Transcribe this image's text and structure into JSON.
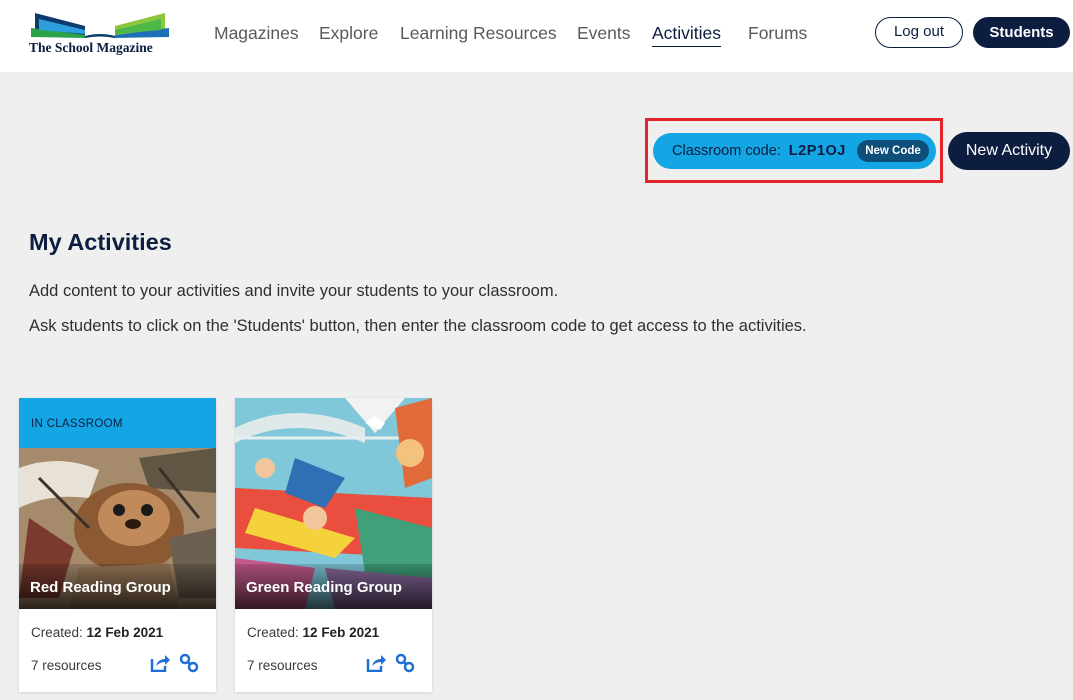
{
  "header": {
    "logo_text": "The School Magazine",
    "nav": [
      {
        "label": "Magazines",
        "active": false
      },
      {
        "label": "Explore",
        "active": false
      },
      {
        "label": "Learning Resources",
        "active": false
      },
      {
        "label": "Events",
        "active": false
      },
      {
        "label": "Activities",
        "active": true
      },
      {
        "label": "Forums",
        "active": false
      }
    ],
    "logout_label": "Log out",
    "students_label": "Students"
  },
  "classroom": {
    "code_label": "Classroom code:",
    "code_value": "L2P1OJ",
    "new_code_label": "New Code",
    "new_activity_label": "New Activity"
  },
  "main": {
    "title": "My Activities",
    "intro_line1": "Add content to your activities and invite your students to your classroom.",
    "intro_line2": "Ask students to click on the 'Students' button, then enter the classroom code to get access to the activities."
  },
  "cards": [
    {
      "badge": "IN CLASSROOM",
      "title": "Red Reading Group",
      "created_label": "Created:",
      "created_date": "12 Feb 2021",
      "resources": "7 resources"
    },
    {
      "badge": "",
      "title": "Green Reading Group",
      "created_label": "Created:",
      "created_date": "12 Feb 2021",
      "resources": "7 resources"
    }
  ],
  "colors": {
    "navy": "#0d1d40",
    "accent_blue": "#14a6e4",
    "highlight_red": "#e3242b",
    "background": "#efefef"
  }
}
